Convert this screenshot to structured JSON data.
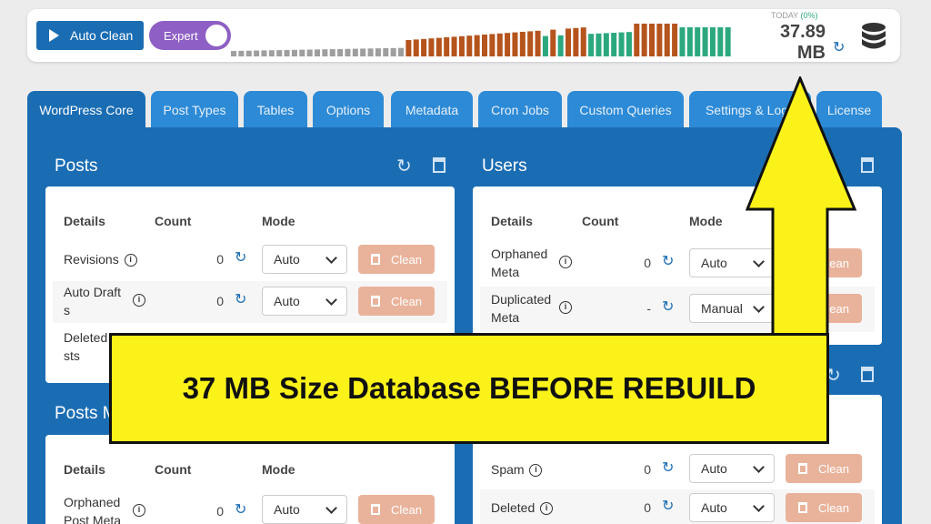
{
  "topbar": {
    "auto_clean_label": "Auto Clean",
    "expert_label": "Expert",
    "today_label": "TODAY",
    "today_pct": "(0%)",
    "size_value": "37.89",
    "size_unit": "MB",
    "bar_chart": {
      "colors": {
        "gray": "#9e9e9e",
        "brown": "#b5541c",
        "green": "#2ca87f"
      },
      "pattern": [
        "gray",
        "gray",
        "gray",
        "gray",
        "gray",
        "gray",
        "gray",
        "gray",
        "gray",
        "gray",
        "gray",
        "gray",
        "gray",
        "gray",
        "gray",
        "gray",
        "gray",
        "gray",
        "gray",
        "gray",
        "gray",
        "gray",
        "gray",
        "brown",
        "brown",
        "brown",
        "brown",
        "brown",
        "brown",
        "brown",
        "brown",
        "brown",
        "brown",
        "brown",
        "brown",
        "brown",
        "brown",
        "brown",
        "brown",
        "brown",
        "brown",
        "green",
        "brown",
        "green",
        "brown",
        "brown",
        "brown",
        "green",
        "green",
        "green",
        "green",
        "green",
        "green",
        "brown",
        "brown",
        "brown",
        "brown",
        "brown",
        "brown",
        "green",
        "green",
        "green",
        "green",
        "green",
        "green",
        "green"
      ]
    }
  },
  "tabs": [
    "WordPress Core",
    "Post Types",
    "Tables",
    "Options",
    "Metadata",
    "Cron Jobs",
    "Custom Queries",
    "Settings & Logs",
    "License"
  ],
  "posts": {
    "title": "Posts",
    "headers": {
      "details": "Details",
      "count": "Count",
      "mode": "Mode"
    },
    "rows": [
      {
        "label": "Revisions",
        "count": "0",
        "mode": "Auto",
        "action": "Clean"
      },
      {
        "label": "Auto Draft",
        "label2": "s",
        "count": "0",
        "mode": "Auto",
        "action": "Clean"
      },
      {
        "label": "Deleted",
        "label2": "sts"
      }
    ]
  },
  "users": {
    "title": "Users",
    "headers": {
      "details": "Details",
      "count": "Count",
      "mode": "Mode"
    },
    "rows": [
      {
        "label": "Orphaned",
        "label2": "Meta",
        "count": "0",
        "mode": "Auto",
        "action": "Clean"
      },
      {
        "label": "Duplicated",
        "label2": "Meta",
        "count": "-",
        "mode": "Manual",
        "action": "Clean"
      }
    ]
  },
  "posts_meta": {
    "title": "Posts M",
    "headers": {
      "details": "Details",
      "count": "Count",
      "mode": "Mode"
    },
    "rows": [
      {
        "label": "Orphaned",
        "label2": "Post Meta",
        "count": "0",
        "mode": "Auto",
        "action": "Clean"
      }
    ]
  },
  "comments": {
    "rows": [
      {
        "label": "Spam",
        "count": "0",
        "mode": "Auto",
        "action": "Clean"
      },
      {
        "label": "Deleted",
        "count": "0",
        "mode": "Auto",
        "action": "Clean"
      }
    ]
  },
  "overlay": {
    "banner_text": "37 MB Size Database BEFORE REBUILD"
  }
}
